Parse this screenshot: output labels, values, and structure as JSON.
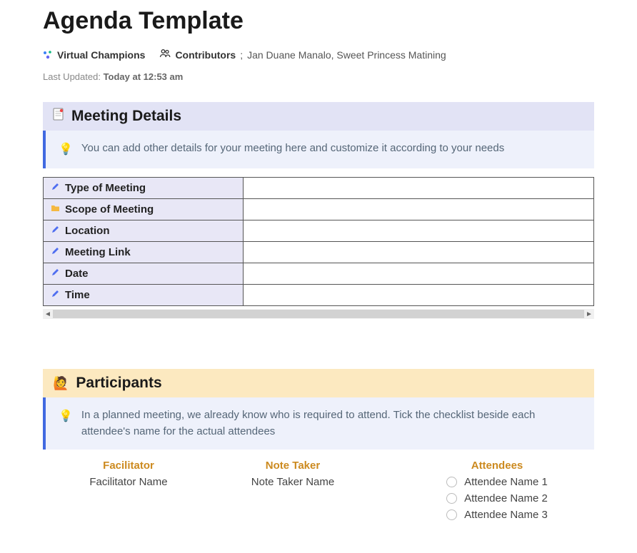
{
  "title": "Agenda Template",
  "meta": {
    "team_name": "Virtual Champions",
    "contributors_label": "Contributors",
    "contributors_sep": ";",
    "contributors_value": "Jan Duane Manalo, Sweet Princess Matining",
    "last_updated_prefix": "Last Updated: ",
    "last_updated_value": "Today at 12:53 am"
  },
  "sections": {
    "meeting_details": {
      "heading": "Meeting Details",
      "callout": "You can add other details for your meeting here and customize it according to your needs",
      "rows": [
        {
          "icon": "pen",
          "label": "Type of Meeting",
          "value": ""
        },
        {
          "icon": "folder",
          "label": "Scope of Meeting",
          "value": ""
        },
        {
          "icon": "pen",
          "label": "Location",
          "value": ""
        },
        {
          "icon": "pen",
          "label": "Meeting Link",
          "value": ""
        },
        {
          "icon": "pen",
          "label": "Date",
          "value": ""
        },
        {
          "icon": "pen",
          "label": "Time",
          "value": ""
        }
      ]
    },
    "participants": {
      "heading": "Participants",
      "callout": "In a planned meeting, we already know who is required to attend. Tick the checklist beside each attendee's name for the actual attendees",
      "facilitator": {
        "label": "Facilitator",
        "value": "Facilitator Name"
      },
      "note_taker": {
        "label": "Note Taker",
        "value": "Note Taker Name"
      },
      "attendees": {
        "label": "Attendees",
        "items": [
          "Attendee Name 1",
          "Attendee Name 2",
          "Attendee Name 3"
        ]
      }
    }
  }
}
